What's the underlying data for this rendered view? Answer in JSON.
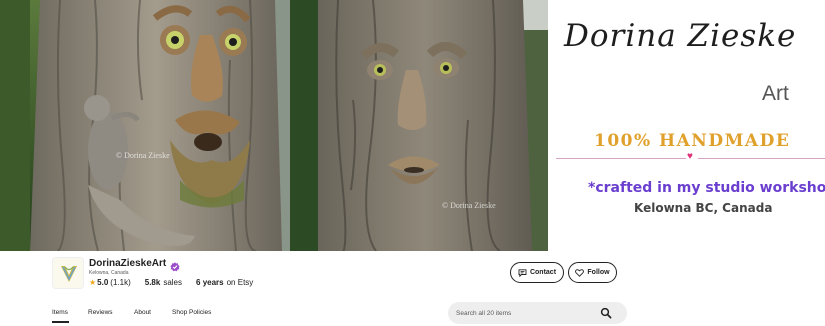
{
  "banner": {
    "brand_name": "Dorina Zieske",
    "brand_subtitle": "Art",
    "tagline": "100% HANDMADE",
    "crafted_text": "*crafted in my studio workshop",
    "location_text": "Kelowna BC, Canada",
    "watermark_left": "© Dorina Zieske",
    "watermark_right": "© Dorina Zieske"
  },
  "shop": {
    "name": "DorinaZieskeArt",
    "location": "Kelowna, Canada",
    "rating": "5.0",
    "rating_count": "(1.1k)",
    "sales_count": "5.8k",
    "sales_label": "sales",
    "years_count": "6 years",
    "years_label": "on Etsy"
  },
  "actions": {
    "contact_label": "Contact",
    "follow_label": "Follow"
  },
  "tabs": [
    {
      "label": "Items",
      "active": true
    },
    {
      "label": "Reviews",
      "active": false
    },
    {
      "label": "About",
      "active": false
    },
    {
      "label": "Shop Policies",
      "active": false
    }
  ],
  "search": {
    "placeholder": "Search all 20 items"
  },
  "colors": {
    "accent_handmade": "#e0a12c",
    "accent_crafted": "#6a3fd0",
    "verified_badge": "#9b4dca",
    "star": "#f0a820"
  }
}
